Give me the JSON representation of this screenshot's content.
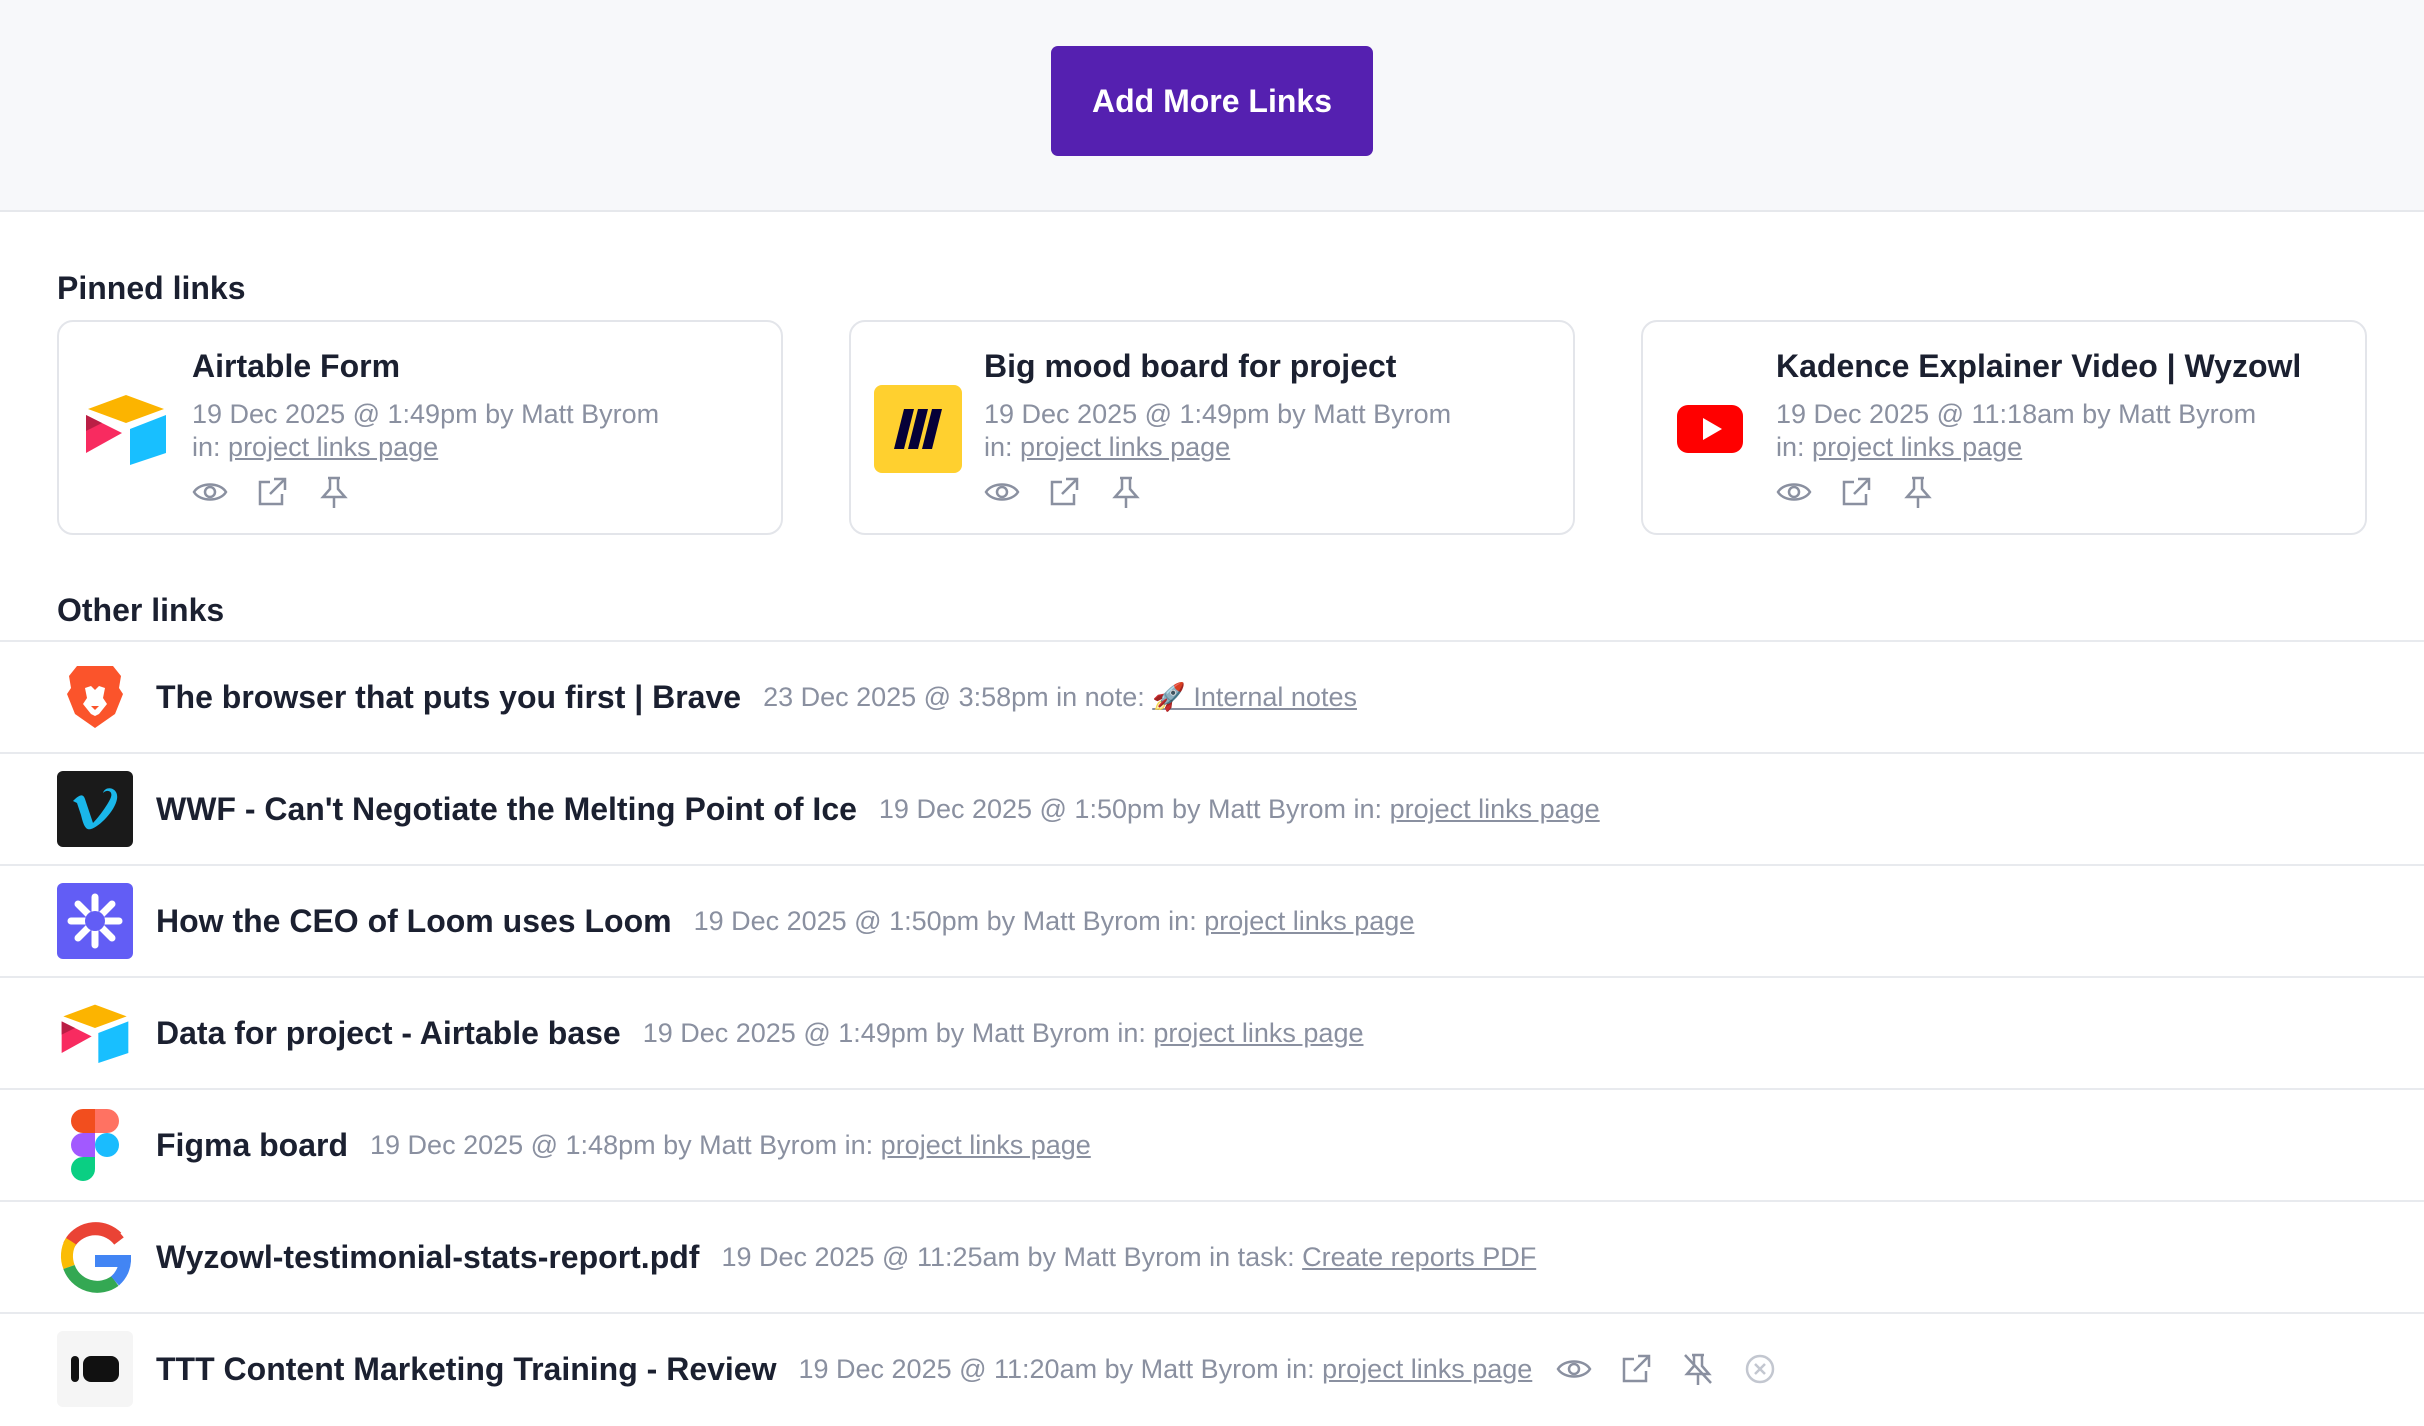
{
  "header": {
    "add_button_label": "Add More Links"
  },
  "pinned": {
    "title": "Pinned links",
    "cards": [
      {
        "title": "Airtable Form",
        "meta": "19 Dec 2025 @ 1:49pm by Matt Byrom",
        "in_prefix": "in:",
        "in_link": "project links page",
        "icon": "airtable-logo"
      },
      {
        "title": "Big mood board for project",
        "meta": "19 Dec 2025 @ 1:49pm by Matt Byrom",
        "in_prefix": "in:",
        "in_link": "project links page",
        "icon": "miro-logo"
      },
      {
        "title": "Kadence Explainer Video | Wyzowl",
        "meta": "19 Dec 2025 @ 11:18am by Matt Byrom",
        "in_prefix": "in:",
        "in_link": "project links page",
        "icon": "youtube-logo"
      }
    ]
  },
  "other": {
    "title": "Other links",
    "rows": [
      {
        "title": "The browser that puts you first | Brave",
        "meta": "23 Dec 2025 @ 3:58pm in note:",
        "link": "🚀 Internal notes",
        "icon": "brave-logo"
      },
      {
        "title": "WWF - Can't Negotiate the Melting Point of Ice",
        "meta": "19 Dec 2025 @ 1:50pm by Matt Byrom in:",
        "link": "project links page",
        "icon": "vimeo-logo"
      },
      {
        "title": "How the CEO of Loom uses Loom",
        "meta": "19 Dec 2025 @ 1:50pm by Matt Byrom in:",
        "link": "project links page",
        "icon": "loom-logo"
      },
      {
        "title": "Data for project - Airtable base",
        "meta": "19 Dec 2025 @ 1:49pm by Matt Byrom in:",
        "link": "project links page",
        "icon": "airtable-logo"
      },
      {
        "title": "Figma board",
        "meta": "19 Dec 2025 @ 1:48pm by Matt Byrom in:",
        "link": "project links page",
        "icon": "figma-logo"
      },
      {
        "title": "Wyzowl-testimonial-stats-report.pdf",
        "meta": "19 Dec 2025 @ 11:25am by Matt Byrom in task:",
        "link": "Create reports PDF",
        "icon": "google-logo"
      },
      {
        "title": "TTT Content Marketing Training - Review",
        "meta": "19 Dec 2025 @ 11:20am by Matt Byrom in:",
        "link": "project links page",
        "icon": "pitch-logo"
      }
    ]
  },
  "colors": {
    "accent": "#5520b0",
    "muted_text": "#8a90a0",
    "border": "#e3e5ea"
  }
}
